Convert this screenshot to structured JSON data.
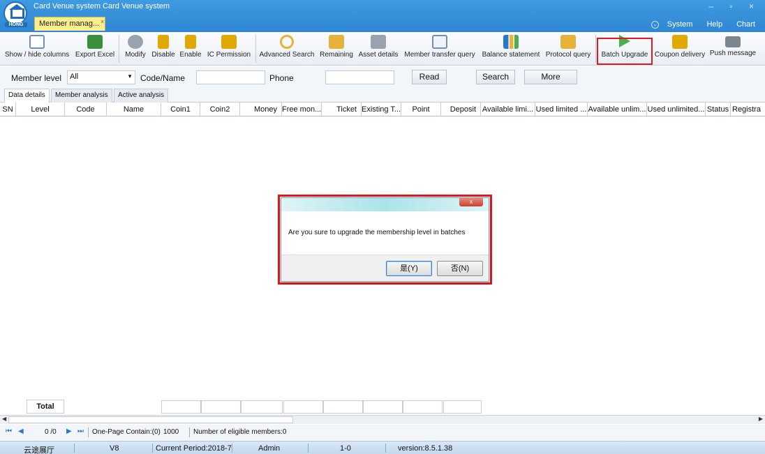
{
  "app": {
    "title": "Card Venue system Card Venue system",
    "brand": "HONG",
    "doc_tab": "Member manag...",
    "window_controls": "– ▫ ×",
    "menus": [
      "System",
      "Help",
      "Chart"
    ]
  },
  "toolbar": [
    {
      "label": "Show / hide columns",
      "icon": "columns-icon",
      "color": "#6f8fb5"
    },
    {
      "label": "Export Excel",
      "icon": "excel-icon",
      "color": "#3b8f3b"
    },
    {
      "label": "Modify",
      "icon": "gear-icon",
      "color": "#9aa3ad"
    },
    {
      "label": "Disable",
      "icon": "lock-icon",
      "color": "#e0a800"
    },
    {
      "label": "Enable",
      "icon": "unlock-icon",
      "color": "#e0a800"
    },
    {
      "label": "IC Permission",
      "icon": "card-icon",
      "color": "#e0a800"
    },
    {
      "label": "Advanced Search",
      "icon": "magnifier-icon",
      "color": "#e6b23a"
    },
    {
      "label": "Remaining",
      "icon": "folder-search-icon",
      "color": "#e6b23a"
    },
    {
      "label": "Asset details",
      "icon": "asset-search-icon",
      "color": "#9aa3ad"
    },
    {
      "label": "Member transfer query",
      "icon": "document-search-icon",
      "color": "#6f8fb5"
    },
    {
      "label": "Balance statement",
      "icon": "bar-chart-icon",
      "color": "#2a78c9"
    },
    {
      "label": "Protocol query",
      "icon": "folder-search-icon",
      "color": "#e6b23a"
    },
    {
      "label": "Batch Upgrade",
      "icon": "play-arrow-icon",
      "color": "#4cae4c"
    },
    {
      "label": "Coupon delivery",
      "icon": "coupon-icon",
      "color": "#e0a800"
    },
    {
      "label": "Push message",
      "icon": "envelope-icon",
      "color": "#7d868f"
    }
  ],
  "filter": {
    "member_level_label": "Member level",
    "member_level_value": "All",
    "code_name_label": "Code/Name",
    "phone_label": "Phone",
    "read_button": "Read",
    "search_button": "Search",
    "more_button": "More"
  },
  "subtabs": [
    "Data details",
    "Member analysis",
    "Active analysis"
  ],
  "columns": [
    "SN",
    "Level",
    "Code",
    "Name",
    "Coin1",
    "Coin2",
    "Money",
    "Free mon...",
    "Ticket",
    "Existing T...",
    "Point",
    "Deposit",
    "Available limi...",
    "Used limited ...",
    "Available unlim...",
    "Used unlimited...",
    "Status",
    "Registra"
  ],
  "total_label": "Total",
  "pager": {
    "page_info": "0 /0",
    "one_page_contain": "One-Page Contain:(0)",
    "page_size": "1000",
    "eligible": "Number of eligible members:0"
  },
  "status": {
    "venue": "云途展厅",
    "version_tag": "V8",
    "period": "Current Period:2018-7",
    "user": "Admin",
    "code": "1-0",
    "version": "version:8.5.1.38"
  },
  "dialog": {
    "message": "Are you sure to upgrade the membership level in batches",
    "yes_label": "是(Y)",
    "no_label": "否(N)",
    "close_label": "x"
  }
}
